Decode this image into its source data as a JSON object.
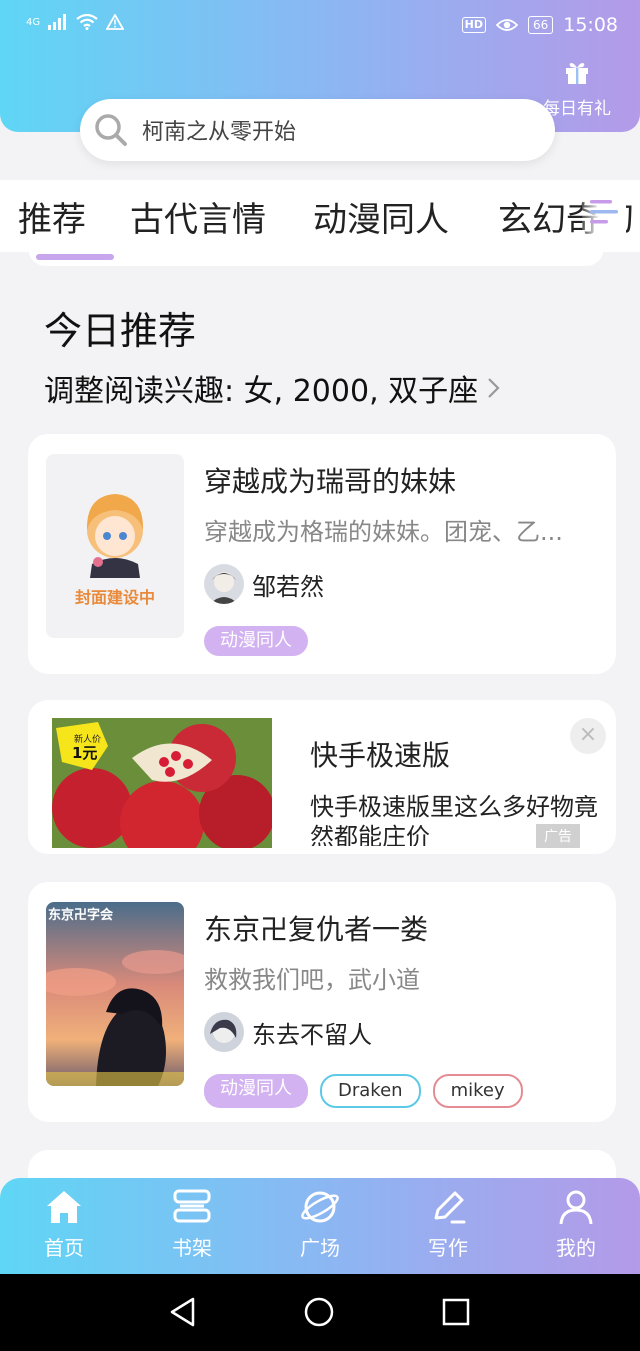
{
  "status_bar": {
    "network": "4G",
    "hd": "HD",
    "battery": "66",
    "time": "15:08"
  },
  "header": {
    "gift_label": "每日有礼"
  },
  "search": {
    "text": "柯南之从零开始"
  },
  "tabs": [
    {
      "label": "推荐"
    },
    {
      "label": "古代言情"
    },
    {
      "label": "动漫同人"
    },
    {
      "label": "玄幻奇幻"
    }
  ],
  "section": {
    "title": "今日推荐",
    "subtitle": "调整阅读兴趣: 女, 2000, 双子座"
  },
  "books": [
    {
      "title": "穿越成为瑞哥的妹妹",
      "description": "穿越成为格瑞的妹妹。团宠、乙...",
      "author": "邹若然",
      "cover_caption": "封面建设中",
      "tags": [
        {
          "label": "动漫同人",
          "style": "fill"
        }
      ]
    },
    {
      "title": "东京卍复仇者一娄",
      "description": "救救我们吧，武小道",
      "author": "东去不留人",
      "cover_caption": "东京卍字会",
      "tags": [
        {
          "label": "动漫同人",
          "style": "fill"
        },
        {
          "label": "Draken",
          "style": "cyan"
        },
        {
          "label": "mikey",
          "style": "rose"
        }
      ]
    }
  ],
  "ad": {
    "title": "快手极速版",
    "description": "快手极速版里这么多好物竟然都能庄价",
    "badge": "广告",
    "close": "×",
    "price_top": "新人价",
    "price": "1元"
  },
  "bottom_nav": [
    {
      "label": "首页",
      "icon": "home-icon"
    },
    {
      "label": "书架",
      "icon": "bookshelf-icon"
    },
    {
      "label": "广场",
      "icon": "planet-icon"
    },
    {
      "label": "写作",
      "icon": "pen-icon"
    },
    {
      "label": "我的",
      "icon": "user-icon"
    }
  ],
  "colors": {
    "gradient_start": "#5fd6f5",
    "gradient_end": "#b49ae8",
    "tag_purple": "#d2b2f0"
  }
}
